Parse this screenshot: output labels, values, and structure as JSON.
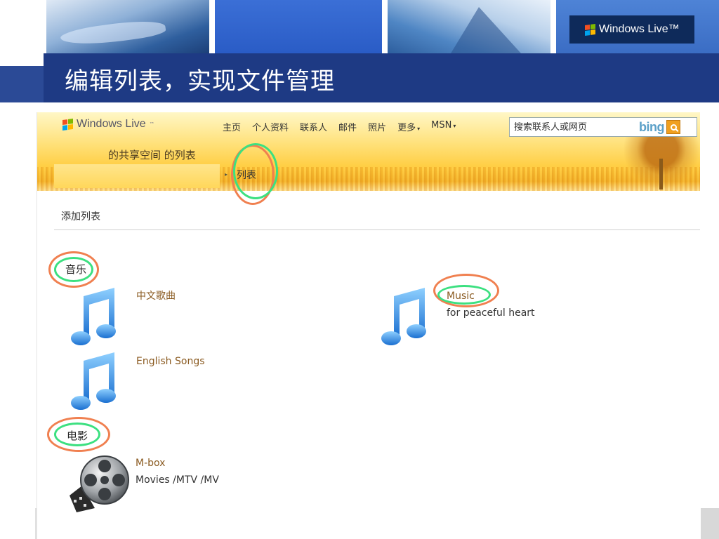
{
  "slide": {
    "title": "编辑列表，实现文件管理",
    "header_badge": "Windows Live™"
  },
  "windows_live": {
    "logo_text": "Windows Live",
    "logo_tm": "™",
    "nav": [
      {
        "label": "主页"
      },
      {
        "label": "个人资料"
      },
      {
        "label": "联系人"
      },
      {
        "label": "邮件"
      },
      {
        "label": "照片"
      },
      {
        "label": "更多",
        "dropdown": true
      },
      {
        "label": "MSN",
        "dropdown": true
      }
    ],
    "search": {
      "placeholder": "搜索联系人或网页",
      "brand": "bing"
    },
    "space_title": "的共享空间  的列表",
    "breadcrumb_sep": "▸",
    "breadcrumb_current": "列表"
  },
  "content": {
    "add_list": "添加列表",
    "sections": [
      {
        "heading": "音乐",
        "items": [
          {
            "title": "中文歌曲",
            "desc": ""
          },
          {
            "title": "English Songs",
            "desc": ""
          },
          {
            "title": "Music",
            "desc": "for peaceful heart"
          }
        ]
      },
      {
        "heading": "电影",
        "items": [
          {
            "title": "M-box",
            "desc": "Movies /MTV /MV"
          }
        ]
      }
    ]
  },
  "colors": {
    "title_bar": "#1e3a84",
    "annotation_orange": "#f08050",
    "annotation_green": "#3ce080",
    "item_title": "#8a5a20",
    "note_blue": "#2a8ae0"
  },
  "icons": {
    "music_item": "music-note-icon",
    "movie_item": "film-reel-icon",
    "search": "search-icon"
  }
}
